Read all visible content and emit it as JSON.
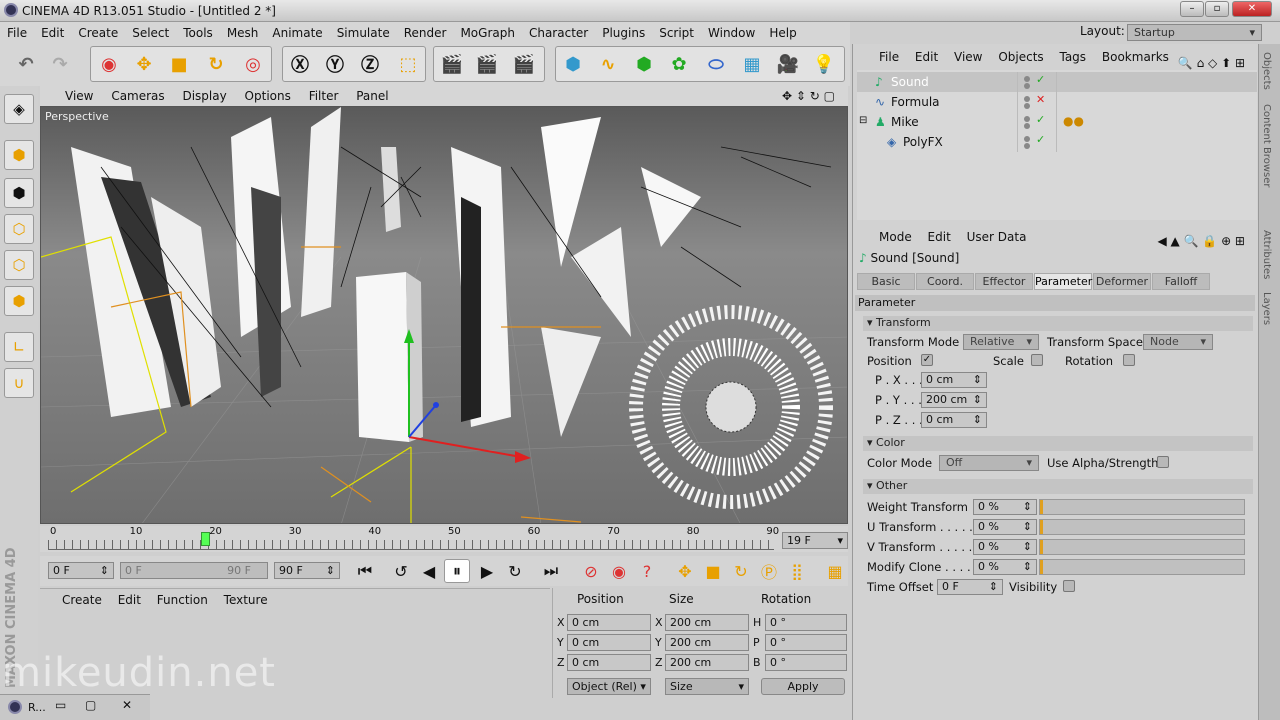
{
  "title_bar": {
    "title": "CINEMA 4D R13.051 Studio - [Untitled 2 *]"
  },
  "menu_bar": {
    "items": [
      "File",
      "Edit",
      "Create",
      "Select",
      "Tools",
      "Mesh",
      "Animate",
      "Simulate",
      "Render",
      "MoGraph",
      "Character",
      "Plugins",
      "Script",
      "Window",
      "Help"
    ]
  },
  "layout": {
    "label": "Layout:",
    "value": "Startup"
  },
  "viewport": {
    "menu": [
      "View",
      "Cameras",
      "Display",
      "Options",
      "Filter",
      "Panel"
    ],
    "label": "Perspective"
  },
  "timeline": {
    "ticks": [
      "0",
      "10",
      "20",
      "30",
      "40",
      "50",
      "60",
      "70",
      "80",
      "90"
    ],
    "current_frame": "19 F",
    "current_frame_value": 19
  },
  "playback": {
    "start": "0 F",
    "range_start": "0 F",
    "range_end": "90 F",
    "end": "90 F"
  },
  "material_manager": {
    "menu": [
      "Create",
      "Edit",
      "Function",
      "Texture"
    ]
  },
  "coordinates": {
    "headers": [
      "Position",
      "Size",
      "Rotation"
    ],
    "rows": [
      {
        "axis": "X",
        "pos": "0 cm",
        "saxis": "X",
        "size": "200 cm",
        "raxis": "H",
        "rot": "0 °"
      },
      {
        "axis": "Y",
        "pos": "0 cm",
        "saxis": "Y",
        "size": "200 cm",
        "raxis": "P",
        "rot": "0 °"
      },
      {
        "axis": "Z",
        "pos": "0 cm",
        "saxis": "Z",
        "size": "200 cm",
        "raxis": "B",
        "rot": "0 °"
      }
    ],
    "mode": "Object (Rel)",
    "size_mode": "Size",
    "apply": "Apply"
  },
  "objects": {
    "menu": [
      "File",
      "Edit",
      "View",
      "Objects",
      "Tags",
      "Bookmarks"
    ],
    "items": [
      {
        "name": "Sound",
        "status": "check"
      },
      {
        "name": "Formula",
        "status": "x"
      },
      {
        "name": "Mike",
        "status": "check"
      },
      {
        "name": "PolyFX",
        "status": "check"
      }
    ]
  },
  "attributes": {
    "menu": [
      "Mode",
      "Edit",
      "User Data"
    ],
    "object_title": "Sound [Sound]",
    "tabs": [
      "Basic",
      "Coord.",
      "Effector",
      "Parameter",
      "Deformer",
      "Falloff"
    ],
    "active_tab": "Parameter",
    "section_header": "Parameter",
    "transform": {
      "header": "Transform",
      "mode_label": "Transform Mode",
      "mode_value": "Relative",
      "space_label": "Transform Space",
      "space_value": "Node",
      "position_label": "Position",
      "scale_label": "Scale",
      "rotation_label": "Rotation",
      "px_label": "P . X . . .",
      "px": "0 cm",
      "py_label": "P . Y . . .",
      "py": "200 cm",
      "pz_label": "P . Z . . .",
      "pz": "0 cm"
    },
    "color": {
      "header": "Color",
      "mode_label": "Color Mode",
      "mode_value": "Off",
      "alpha_label": "Use Alpha/Strength"
    },
    "other": {
      "header": "Other",
      "weight_label": "Weight Transform",
      "weight": "0 %",
      "u_label": "U Transform . . . . .",
      "u": "0 %",
      "v_label": "V Transform . . . . .",
      "v": "0 %",
      "clone_label": "Modify Clone . . . . .",
      "clone": "0 %",
      "time_label": "Time Offset",
      "time": "0 F",
      "visibility_label": "Visibility"
    }
  },
  "side_tabs": [
    "Objects",
    "Content Browser",
    "Attributes",
    "Layers"
  ],
  "watermark": "mikeudin.net",
  "brand": "MAXON CINEMA 4D",
  "taskbar": {
    "label": "R..."
  }
}
